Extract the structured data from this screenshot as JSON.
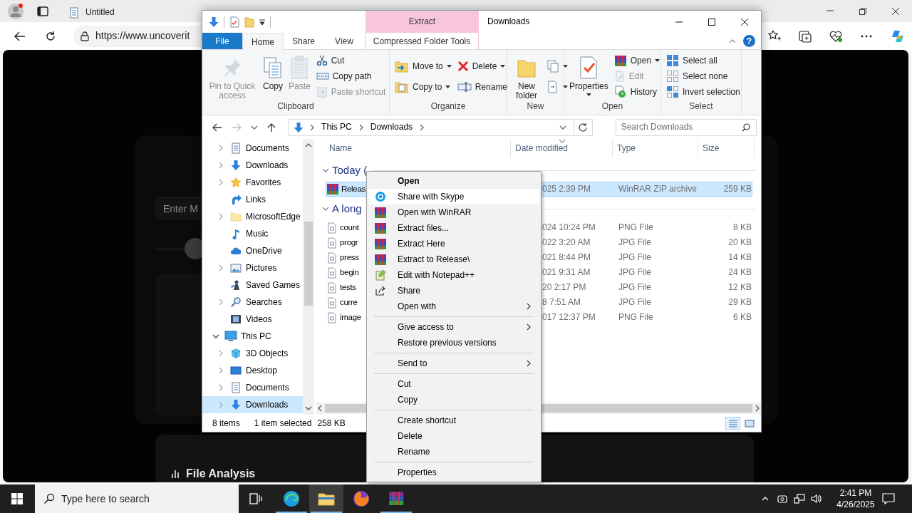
{
  "browser": {
    "tab_title": "Untitled",
    "address": "https://www.uncoverit"
  },
  "page": {
    "input": {
      "placeholder": "Enter M"
    },
    "section_title": "File Analysis"
  },
  "explorer": {
    "title": "Downloads",
    "context_header": "Extract",
    "help": "?",
    "tabs": [
      {
        "label": "File",
        "kind": "file",
        "selected": false
      },
      {
        "label": "Home",
        "kind": "tab",
        "selected": true
      },
      {
        "label": "Share",
        "kind": "tab",
        "selected": false
      },
      {
        "label": "View",
        "kind": "tab",
        "selected": false
      },
      {
        "label": "Compressed Folder Tools",
        "kind": "contextual",
        "selected": false
      }
    ],
    "ribbon": [
      {
        "label": "Clipboard",
        "columns": [
          [
            {
              "label": "Pin to Quick access",
              "kind": "large",
              "disabled": true,
              "dropdown": false
            }
          ],
          [
            {
              "label": "Copy",
              "kind": "large",
              "disabled": false,
              "dropdown": false
            }
          ],
          [
            {
              "label": "Paste",
              "kind": "large",
              "disabled": true,
              "dropdown": false
            }
          ],
          [
            {
              "label": "Cut",
              "kind": "small",
              "disabled": false,
              "dropdown": false
            },
            {
              "label": "Copy path",
              "kind": "small",
              "disabled": false,
              "dropdown": false
            },
            {
              "label": "Paste shortcut",
              "kind": "small",
              "disabled": true,
              "dropdown": false
            }
          ]
        ]
      },
      {
        "label": "Organize",
        "columns": [
          [
            {
              "label": "Move to",
              "kind": "small",
              "disabled": false,
              "dropdown": true
            },
            {
              "label": "Copy to",
              "kind": "small",
              "disabled": false,
              "dropdown": true
            }
          ],
          [
            {
              "label": "Delete",
              "kind": "small",
              "disabled": false,
              "dropdown": true
            },
            {
              "label": "Rename",
              "kind": "small",
              "disabled": false,
              "dropdown": false
            }
          ]
        ]
      },
      {
        "label": "New",
        "columns": [
          [
            {
              "label": "New folder",
              "kind": "large",
              "disabled": false,
              "dropdown": false
            }
          ],
          [
            {
              "kind": "small",
              "disabled": false,
              "dropdown": true
            },
            {
              "kind": "small",
              "disabled": false,
              "dropdown": true
            }
          ]
        ]
      },
      {
        "label": "Open",
        "columns": [
          [
            {
              "label": "Properties",
              "kind": "large",
              "disabled": false,
              "dropdown": true
            }
          ],
          [
            {
              "label": "Open",
              "kind": "small",
              "disabled": false,
              "dropdown": true
            },
            {
              "label": "Edit",
              "kind": "small",
              "disabled": true,
              "dropdown": false
            },
            {
              "label": "History",
              "kind": "small",
              "disabled": false,
              "dropdown": false
            }
          ]
        ]
      },
      {
        "label": "Select",
        "columns": [
          [
            {
              "label": "Select all",
              "kind": "small",
              "disabled": false,
              "dropdown": false
            },
            {
              "label": "Select none",
              "kind": "small",
              "disabled": false,
              "dropdown": false
            },
            {
              "label": "Invert selection",
              "kind": "small",
              "disabled": false,
              "dropdown": false
            }
          ]
        ]
      }
    ],
    "breadcrumbs": [
      "This PC",
      "Downloads"
    ],
    "search": {
      "placeholder": "Search Downloads"
    },
    "nav": [
      {
        "children": [
          {
            "label": "Documents",
            "expandable": true,
            "expanded": false,
            "selected": false
          },
          {
            "label": "Downloads",
            "expandable": true,
            "expanded": false,
            "selected": false
          },
          {
            "label": "Favorites",
            "expandable": true,
            "expanded": false,
            "selected": false
          },
          {
            "label": "Links",
            "expandable": false,
            "selected": false
          },
          {
            "label": "MicrosoftEdge",
            "expandable": true,
            "expanded": false,
            "selected": false
          },
          {
            "label": "Music",
            "expandable": false,
            "selected": false
          },
          {
            "label": "OneDrive",
            "expandable": false,
            "selected": false
          },
          {
            "label": "Pictures",
            "expandable": true,
            "expanded": false,
            "selected": false
          },
          {
            "label": "Saved Games",
            "expandable": false,
            "selected": false
          },
          {
            "label": "Searches",
            "expandable": true,
            "expanded": false,
            "selected": false
          },
          {
            "label": "Videos",
            "expandable": false,
            "selected": false
          }
        ]
      },
      {
        "label": "This PC",
        "expandable": true,
        "expanded": true,
        "selected": false,
        "children": [
          {
            "label": "3D Objects",
            "expandable": true,
            "expanded": false,
            "selected": false
          },
          {
            "label": "Desktop",
            "expandable": true,
            "expanded": false,
            "selected": false
          },
          {
            "label": "Documents",
            "expandable": true,
            "expanded": false,
            "selected": false
          },
          {
            "label": "Downloads",
            "expandable": true,
            "expanded": false,
            "selected": true
          }
        ]
      }
    ],
    "columns": [
      "Name",
      "Date modified",
      "Type",
      "Size"
    ],
    "groups": [
      {
        "label": "Today (",
        "expanded": true,
        "files": [
          {
            "name": "Releas",
            "kind": "archive",
            "date": "025 2:39 PM",
            "type": "WinRAR ZIP archive",
            "size": "259 KB",
            "selected": true
          }
        ]
      },
      {
        "label": "A long",
        "expanded": true,
        "files": [
          {
            "name": "count",
            "kind": "image",
            "date": "024 10:24 PM",
            "type": "PNG File",
            "size": "8 KB",
            "selected": false
          },
          {
            "name": "progr",
            "kind": "image",
            "date": "022 3:20 AM",
            "type": "JPG File",
            "size": "20 KB",
            "selected": false
          },
          {
            "name": "press",
            "kind": "image",
            "date": "021 8:44 PM",
            "type": "JPG File",
            "size": "14 KB",
            "selected": false
          },
          {
            "name": "begin",
            "kind": "image",
            "date": "021 9:31 AM",
            "type": "JPG File",
            "size": "24 KB",
            "selected": false
          },
          {
            "name": "tests",
            "kind": "image",
            "date": "20 2:17 PM",
            "type": "JPG File",
            "size": "12 KB",
            "selected": false
          },
          {
            "name": "curre",
            "kind": "image",
            "date": "8 7:51 AM",
            "type": "JPG File",
            "size": "29 KB",
            "selected": false
          },
          {
            "name": "image",
            "kind": "image",
            "date": "017 12:37 PM",
            "type": "PNG File",
            "size": "6 KB",
            "selected": false
          }
        ]
      }
    ],
    "status": {
      "count": "8 items",
      "selection": "1 item selected",
      "size": "258 KB"
    },
    "views": [
      {
        "selected": true
      },
      {
        "selected": false
      }
    ]
  },
  "context_menu": [
    {
      "kind": "item",
      "label": "Open",
      "default": true,
      "selected": false,
      "submenu": false
    },
    {
      "kind": "item",
      "label": "Share with Skype",
      "default": false,
      "selected": true,
      "submenu": false
    },
    {
      "kind": "item",
      "label": "Open with WinRAR",
      "default": false,
      "selected": false,
      "submenu": false
    },
    {
      "kind": "item",
      "label": "Extract files...",
      "default": false,
      "selected": false,
      "submenu": false
    },
    {
      "kind": "item",
      "label": "Extract Here",
      "default": false,
      "selected": false,
      "submenu": false
    },
    {
      "kind": "item",
      "label": "Extract to Release\\",
      "default": false,
      "selected": false,
      "submenu": false
    },
    {
      "kind": "item",
      "label": "Edit with Notepad++",
      "default": false,
      "selected": false,
      "submenu": false
    },
    {
      "kind": "item",
      "label": "Share",
      "default": false,
      "selected": false,
      "submenu": false
    },
    {
      "kind": "item",
      "label": "Open with",
      "default": false,
      "selected": false,
      "submenu": true
    },
    {
      "kind": "separator"
    },
    {
      "kind": "item",
      "label": "Give access to",
      "default": false,
      "selected": false,
      "submenu": true
    },
    {
      "kind": "item",
      "label": "Restore previous versions",
      "default": false,
      "selected": false,
      "submenu": false
    },
    {
      "kind": "separator"
    },
    {
      "kind": "item",
      "label": "Send to",
      "default": false,
      "selected": false,
      "submenu": true
    },
    {
      "kind": "separator"
    },
    {
      "kind": "item",
      "label": "Cut",
      "default": false,
      "selected": false,
      "submenu": false
    },
    {
      "kind": "item",
      "label": "Copy",
      "default": false,
      "selected": false,
      "submenu": false
    },
    {
      "kind": "separator"
    },
    {
      "kind": "item",
      "label": "Create shortcut",
      "default": false,
      "selected": false,
      "submenu": false
    },
    {
      "kind": "item",
      "label": "Delete",
      "default": false,
      "selected": false,
      "submenu": false
    },
    {
      "kind": "item",
      "label": "Rename",
      "default": false,
      "selected": false,
      "submenu": false
    },
    {
      "kind": "separator"
    },
    {
      "kind": "item",
      "label": "Properties",
      "default": false,
      "selected": false,
      "submenu": false
    }
  ],
  "taskbar": {
    "search": {
      "placeholder": "Type here to search"
    },
    "apps": [
      {
        "running": true,
        "selected": false
      },
      {
        "running": true,
        "selected": true
      },
      {
        "running": false,
        "selected": false
      },
      {
        "running": true,
        "selected": false
      }
    ],
    "time": "2:41 PM",
    "date": "4/26/2025"
  }
}
